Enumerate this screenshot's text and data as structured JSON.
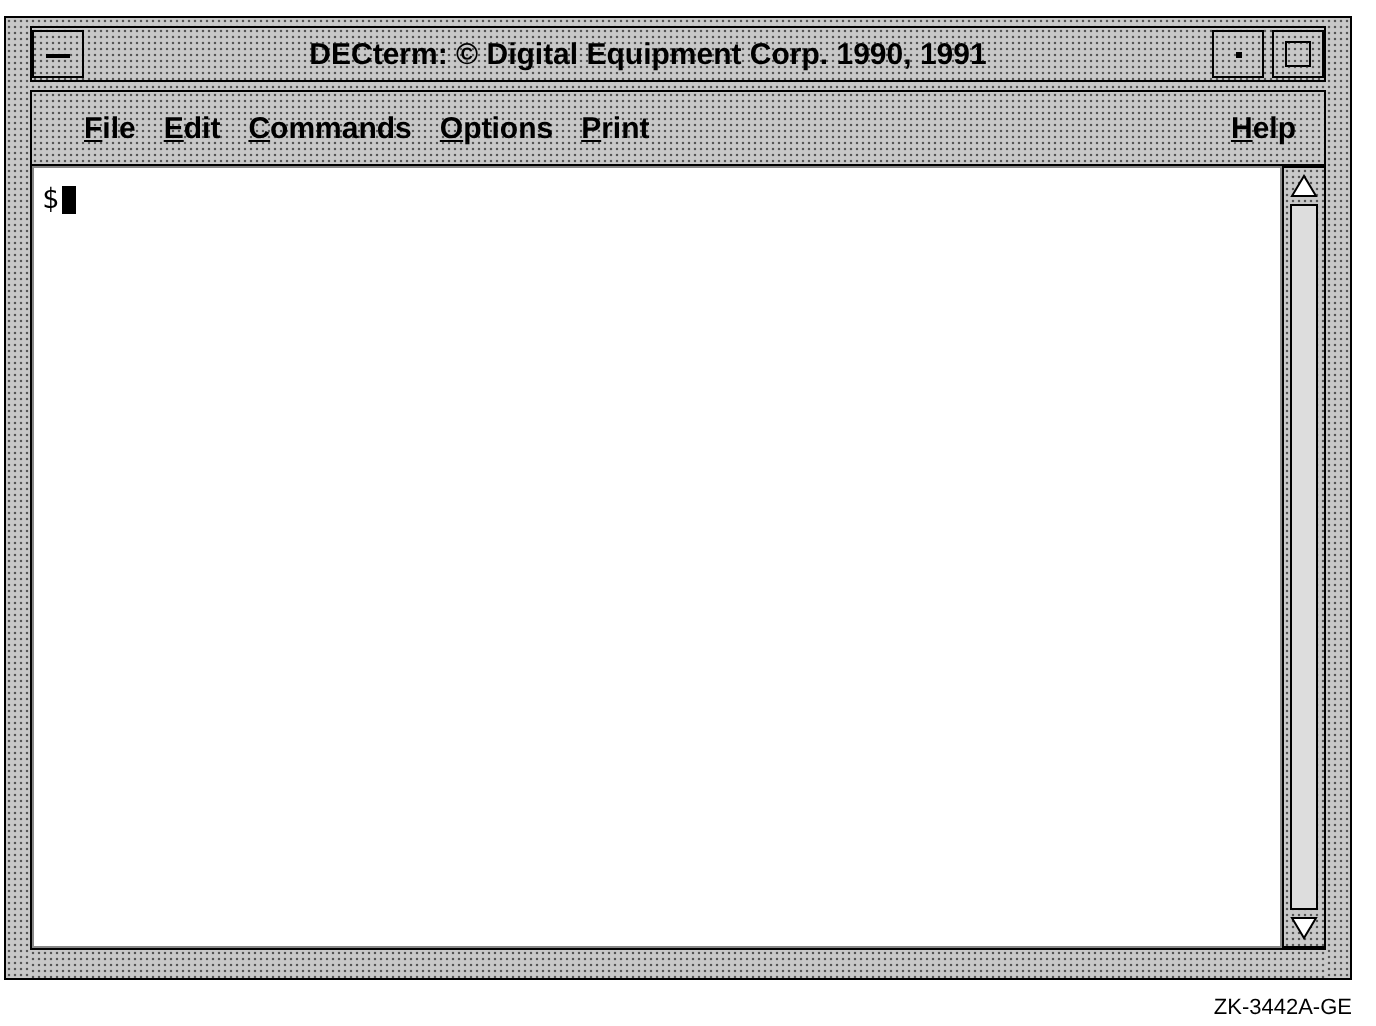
{
  "window": {
    "title": "DECterm: © Digital Equipment Corp. 1990, 1991"
  },
  "menu": [
    {
      "label": "File"
    },
    {
      "label": "Edit"
    },
    {
      "label": "Commands"
    },
    {
      "label": "Options"
    },
    {
      "label": "Print"
    }
  ],
  "help_menu": {
    "label": "Help"
  },
  "terminal": {
    "prompt": "$"
  },
  "figure_code": "ZK-3442A-GE"
}
